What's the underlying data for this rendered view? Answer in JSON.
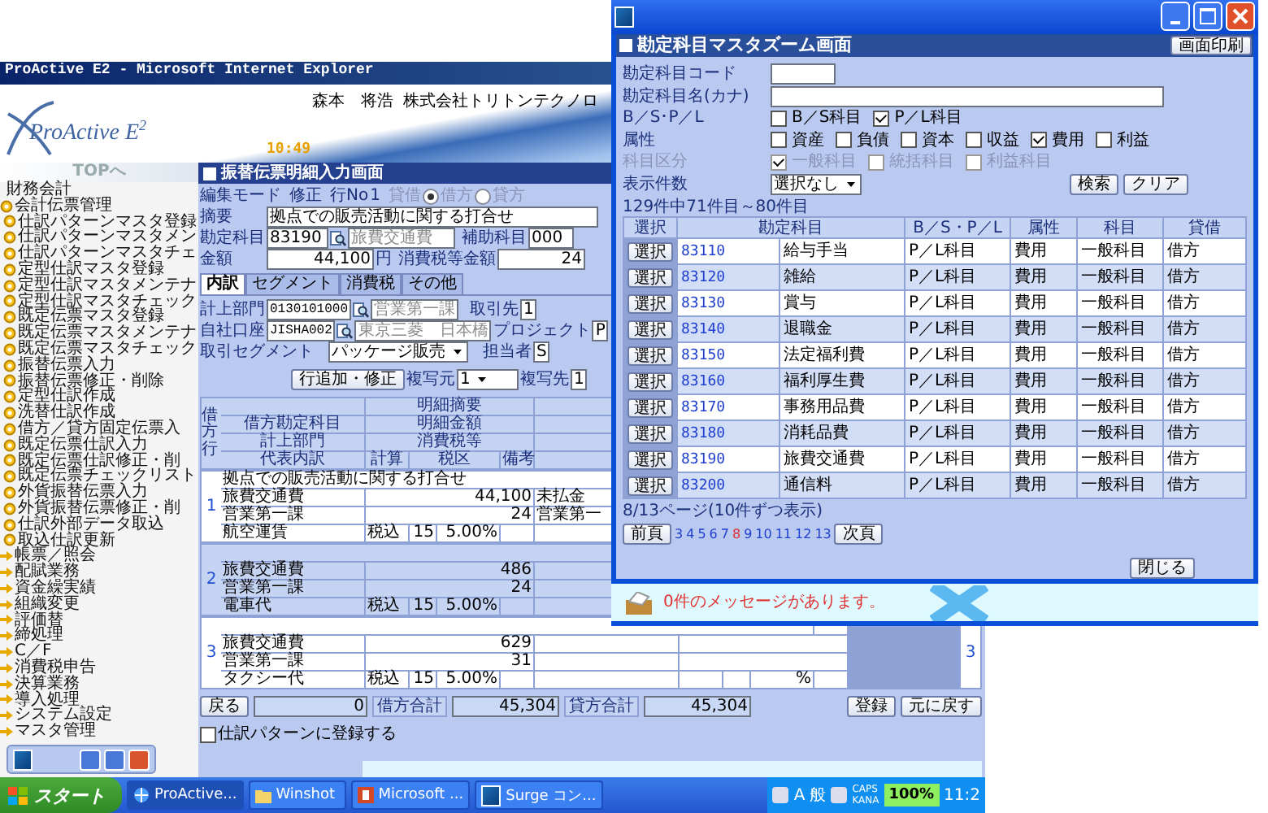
{
  "browser_window": {
    "title": "ProActive E2 - Microsoft Internet Explorer"
  },
  "header": {
    "logo": "ProActive E$^{2}$",
    "user": "森本　将浩",
    "company": "株式会社トリトンテクノロ",
    "time": "10:49",
    "top_link": "TOPへ"
  },
  "sidebar": {
    "root": "財務会計",
    "items": [
      {
        "label": "会計伝票管理",
        "expanded": true,
        "children": [
          {
            "label": "仕訳パターンマスタ登録"
          },
          {
            "label": "仕訳パターンマスタメン"
          },
          {
            "label": "仕訳パターンマスタチェ"
          },
          {
            "label": "定型仕訳マスタ登録"
          },
          {
            "label": "定型仕訳マスタメンテナ"
          },
          {
            "label": "定型仕訳マスタチェック"
          },
          {
            "label": "既定伝票マスタ登録"
          },
          {
            "label": "既定伝票マスタメンテナ"
          },
          {
            "label": "既定伝票マスタチェック"
          },
          {
            "label": "振替伝票入力"
          },
          {
            "label": "振替伝票修正・削除"
          },
          {
            "label": "定型仕訳作成"
          },
          {
            "label": "洗替仕訳作成"
          },
          {
            "label": "借方／貸方固定伝票入"
          },
          {
            "label": "既定伝票仕訳入力"
          },
          {
            "label": "既定伝票仕訳修正・削"
          },
          {
            "label": "既定伝票チェックリスト"
          },
          {
            "label": "外貨振替伝票入力"
          },
          {
            "label": "外貨振替伝票修正・削"
          },
          {
            "label": "仕訳外部データ取込"
          },
          {
            "label": "取込仕訳更新"
          }
        ]
      },
      {
        "label": "帳票／照会",
        "expanded": false
      },
      {
        "label": "配賦業務",
        "expanded": false
      },
      {
        "label": "資金繰実績",
        "expanded": false
      },
      {
        "label": "組織変更",
        "expanded": false
      },
      {
        "label": "評価替",
        "expanded": false
      },
      {
        "label": "締処理",
        "expanded": false
      },
      {
        "label": "C／F",
        "expanded": false
      },
      {
        "label": "消費税申告",
        "expanded": false
      },
      {
        "label": "決算業務",
        "expanded": false
      },
      {
        "label": "導入処理",
        "expanded": false
      },
      {
        "label": "システム設定",
        "expanded": false
      },
      {
        "label": "マスタ管理",
        "expanded": false
      }
    ]
  },
  "entry_form": {
    "title": "振替伝票明細入力画面",
    "edit_mode_label": "編集モード",
    "edit_mode": "修正",
    "line_no_label": "行No",
    "line_no": "1",
    "side_label": "貸借",
    "side_options": [
      {
        "label": "借方",
        "selected": true
      },
      {
        "label": "貸方",
        "selected": false
      }
    ],
    "summary_label": "摘要",
    "summary": "拠点での販売活動に関する打合せ",
    "account_label": "勘定科目",
    "account_code": "83190",
    "account_name": "旅費交通費",
    "sub_account_label": "補助科目",
    "sub_account": "000",
    "amount_label": "金額",
    "amount": "44,100",
    "yen": "円",
    "tax_label": "消費税等金額",
    "tax_amount": "24"
  },
  "tabs": [
    {
      "label": "内訳",
      "selected": true
    },
    {
      "label": "セグメント",
      "selected": false
    },
    {
      "label": "消費税",
      "selected": false
    },
    {
      "label": "その他",
      "selected": false
    }
  ],
  "breakdown": {
    "dept_label": "計上部門",
    "dept_code": "0130101000",
    "dept_name": "営業第一課",
    "client_label": "取引先",
    "client": "1",
    "account_label": "自社口座",
    "bank_code": "JISHA002",
    "bank_name": "東京三菱　日本橋",
    "project_label": "プロジェクト",
    "project": "P",
    "segment_label": "取引セグメント",
    "segment": "パッケージ販売",
    "staff_label": "担当者",
    "staff": "S"
  },
  "actions": {
    "add_row": "行追加・修正",
    "copy_from_label": "複写元",
    "copy_from": "1",
    "copy_to_label": "複写先",
    "copy_to": "1"
  },
  "detail_table": {
    "headers": {
      "row_no": "借方行",
      "summary": "明細摘要",
      "account": "借方勘定科目",
      "amount": "明細金額",
      "department": "計上部門",
      "tax": "消費税等",
      "breakdown": "代表内訳",
      "calc": "計算",
      "tax_class": "税区",
      "remarks": "備考"
    },
    "rows": [
      {
        "no": "1",
        "summary": "拠点での販売活動に関する打合せ",
        "account": "旅費交通費",
        "amount": "44,100",
        "department": "営業第一課",
        "tax": "24",
        "breakdown": "航空運賃",
        "calc": "税込",
        "tax_class": "15",
        "rate": "5.00%",
        "credit_account": "未払金",
        "credit_department": "営業第一"
      },
      {
        "no": "2",
        "account": "旅費交通費",
        "amount": "486",
        "department": "営業第一課",
        "tax": "24",
        "breakdown": "電車代",
        "calc": "税込",
        "tax_class": "15",
        "rate": "5.00%"
      },
      {
        "no": "3",
        "account": "旅費交通費",
        "amount": "629",
        "department": "営業第一課",
        "tax": "31",
        "breakdown": "タクシー代",
        "calc": "税込",
        "tax_class": "15",
        "rate": "5.00%",
        "credit_rate": "%",
        "credit_no": "3"
      }
    ]
  },
  "footer": {
    "back": "戻る",
    "zero": "0",
    "debit_total_label": "借方合計",
    "debit_total": "45,304",
    "credit_total_label": "貸方合計",
    "credit_total": "45,304",
    "register": "登録",
    "revert": "元に戻す"
  },
  "register_pattern": {
    "label": "仕訳パターンに登録する",
    "checked": false
  },
  "zoom_dialog": {
    "title": "勘定科目マスタズーム画面",
    "print": "画面印刷",
    "code_label": "勘定科目コード",
    "kana_label": "勘定科目名(カナ)",
    "bspl_label": "B／S･P／L",
    "bspl": [
      {
        "label": "B／S科目",
        "checked": false
      },
      {
        "label": "P／L科目",
        "checked": true
      }
    ],
    "attr_label": "属性",
    "attrs": [
      {
        "label": "資産",
        "checked": false
      },
      {
        "label": "負債",
        "checked": false
      },
      {
        "label": "資本",
        "checked": false
      },
      {
        "label": "収益",
        "checked": false
      },
      {
        "label": "費用",
        "checked": true
      },
      {
        "label": "利益",
        "checked": false
      }
    ],
    "class_label": "科目区分",
    "class_disabled": true,
    "classes": [
      {
        "label": "一般科目",
        "checked": true
      },
      {
        "label": "統括科目",
        "checked": false
      },
      {
        "label": "利益科目",
        "checked": false
      }
    ],
    "count_label": "表示件数",
    "count_value": "選択なし",
    "search": "検索",
    "clear": "クリア",
    "result_info": "129件中71件目～80件目",
    "columns": [
      "選択",
      "勘定科目",
      "B／S・P／L",
      "属性",
      "科目",
      "貸借"
    ],
    "rows": [
      {
        "select": "選択",
        "code": "83110",
        "name": "給与手当",
        "bspl": "P／L科目",
        "attr": "費用",
        "category": "一般科目",
        "side": "借方"
      },
      {
        "select": "選択",
        "code": "83120",
        "name": "雑給",
        "bspl": "P／L科目",
        "attr": "費用",
        "category": "一般科目",
        "side": "借方"
      },
      {
        "select": "選択",
        "code": "83130",
        "name": "賞与",
        "bspl": "P／L科目",
        "attr": "費用",
        "category": "一般科目",
        "side": "借方"
      },
      {
        "select": "選択",
        "code": "83140",
        "name": "退職金",
        "bspl": "P／L科目",
        "attr": "費用",
        "category": "一般科目",
        "side": "借方"
      },
      {
        "select": "選択",
        "code": "83150",
        "name": "法定福利費",
        "bspl": "P／L科目",
        "attr": "費用",
        "category": "一般科目",
        "side": "借方"
      },
      {
        "select": "選択",
        "code": "83160",
        "name": "福利厚生費",
        "bspl": "P／L科目",
        "attr": "費用",
        "category": "一般科目",
        "side": "借方"
      },
      {
        "select": "選択",
        "code": "83170",
        "name": "事務用品費",
        "bspl": "P／L科目",
        "attr": "費用",
        "category": "一般科目",
        "side": "借方"
      },
      {
        "select": "選択",
        "code": "83180",
        "name": "消耗品費",
        "bspl": "P／L科目",
        "attr": "費用",
        "category": "一般科目",
        "side": "借方"
      },
      {
        "select": "選択",
        "code": "83190",
        "name": "旅費交通費",
        "bspl": "P／L科目",
        "attr": "費用",
        "category": "一般科目",
        "side": "借方"
      },
      {
        "select": "選択",
        "code": "83200",
        "name": "通信料",
        "bspl": "P／L科目",
        "attr": "費用",
        "category": "一般科目",
        "side": "借方"
      }
    ],
    "page_info": "8/13ページ(10件ずつ表示)",
    "prev": "前頁",
    "pages": [
      {
        "label": "3",
        "selected": false
      },
      {
        "label": "4",
        "selected": false
      },
      {
        "label": "5",
        "selected": false
      },
      {
        "label": "6",
        "selected": false
      },
      {
        "label": "7",
        "selected": false
      },
      {
        "label": "8",
        "selected": true
      },
      {
        "label": "9",
        "selected": false
      },
      {
        "label": "10",
        "selected": false
      },
      {
        "label": "11",
        "selected": false
      },
      {
        "label": "12",
        "selected": false
      },
      {
        "label": "13",
        "selected": false
      }
    ],
    "next": "次頁",
    "close": "閉じる",
    "message": "0件のメッセージがあります。"
  },
  "taskbar": {
    "start": "スタート",
    "tasks": [
      {
        "label": "ProActive...",
        "kind": "browser",
        "selected": true
      },
      {
        "label": "Winshot",
        "kind": "folder",
        "selected": false
      },
      {
        "label": "Microsoft ...",
        "kind": "office",
        "selected": false
      },
      {
        "label": "Surge コン...",
        "kind": "surge",
        "selected": false
      }
    ],
    "ime_a": "A",
    "ime_mode": "般",
    "caps": "CAPS",
    "kana": "KANA",
    "battery": "100%",
    "clock": "11:2"
  }
}
